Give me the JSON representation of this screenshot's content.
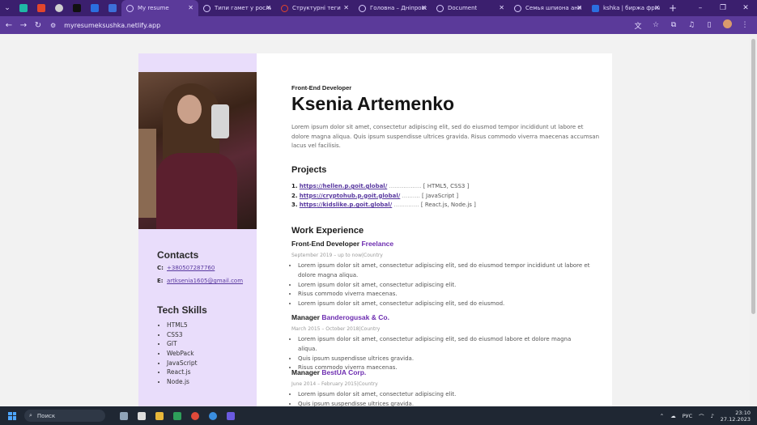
{
  "browser": {
    "tabs": [
      {
        "label": "My resume",
        "active": true
      },
      {
        "label": "Типи гамет у рослин",
        "active": false
      },
      {
        "label": "Структурні теги",
        "active": false
      },
      {
        "label": "Головна – Дніпровськ",
        "active": false
      },
      {
        "label": "Document",
        "active": false
      },
      {
        "label": "Семья шпиона аниме",
        "active": false
      },
      {
        "label": "kshka | биржа фрилан",
        "active": false
      }
    ],
    "url": "myresumeksushka.netlify.app",
    "colors": {
      "tabbar": "#3b1f6e",
      "toolbar": "#5b3a9a"
    }
  },
  "sidebar": {
    "contacts_title": "Contacts",
    "contacts": [
      {
        "key": "C:",
        "value": "+380507287760"
      },
      {
        "key": "E:",
        "value": "artksenia1605@gmail.com"
      }
    ],
    "skills_title": "Tech Skills",
    "skills": [
      "HTML5",
      "CSS3",
      "GIT",
      "WebPack",
      "JavaScript",
      "React.js",
      "Node.js"
    ],
    "colors": {
      "background": "#e9ddfb"
    }
  },
  "main": {
    "role": "Front-End Developer",
    "name": "Ksenia Artemenko",
    "intro": "Lorem ipsum dolor sit amet, consectetur adipiscing elit, sed do eiusmod tempor incididunt ut labore et dolore magna aliqua. Quis ipsum suspendisse ultrices gravida. Risus commodo viverra maecenas accumsan lacus vel facilisis.",
    "projects_title": "Projects",
    "projects": [
      {
        "num": "1.",
        "link": "https://hellen.p.goit.global/",
        "dots": "..................",
        "tech": "[ HTML5, CSS3 ]"
      },
      {
        "num": "2.",
        "link": "https://cryptohub.p.goit.global/",
        "dots": "..........",
        "tech": "[ JavaScript ]"
      },
      {
        "num": "3.",
        "link": "https://kidslike.p.goit.global/",
        "dots": "..............",
        "tech": "[ React.js, Node.js ]"
      }
    ],
    "experience_title": "Work Experience",
    "jobs": [
      {
        "title": "Front-End Developer",
        "company": "Freelance",
        "date": "September 2019 – up to now|Country",
        "bullets": [
          "Lorem ipsum dolor sit amet, consectetur adipiscing elit, sed do eiusmod tempor incididunt ut labore et dolore magna aliqua.",
          "Lorem ipsum dolor sit amet, consectetur adipiscing elit.",
          "Risus commodo viverra maecenas.",
          "Lorem ipsum dolor sit amet, consectetur adipiscing elit, sed do eiusmod."
        ]
      },
      {
        "title": "Manager",
        "company": "Banderogusak & Co.",
        "date": "March 2015 – October 2018|Country",
        "bullets": [
          "Lorem ipsum dolor sit amet, consectetur adipiscing elit, sed do eiusmod labore et dolore magna aliqua.",
          "Quis ipsum suspendisse ultrices gravida.",
          "Risus commodo viverra maecenas."
        ]
      },
      {
        "title": "Manager",
        "company": "BestUA Corp.",
        "date": "June 2014 – February 2015|Country",
        "bullets": [
          "Lorem ipsum dolor sit amet, consectetur adipiscing elit.",
          "Quis ipsum suspendisse ultrices gravida."
        ]
      }
    ],
    "colors": {
      "accent": "#6d2db0",
      "link": "#5a3aa0"
    }
  },
  "taskbar": {
    "search_label": "Поиск",
    "lang": "РУС",
    "time": "23:10",
    "date": "27.12.2023"
  }
}
